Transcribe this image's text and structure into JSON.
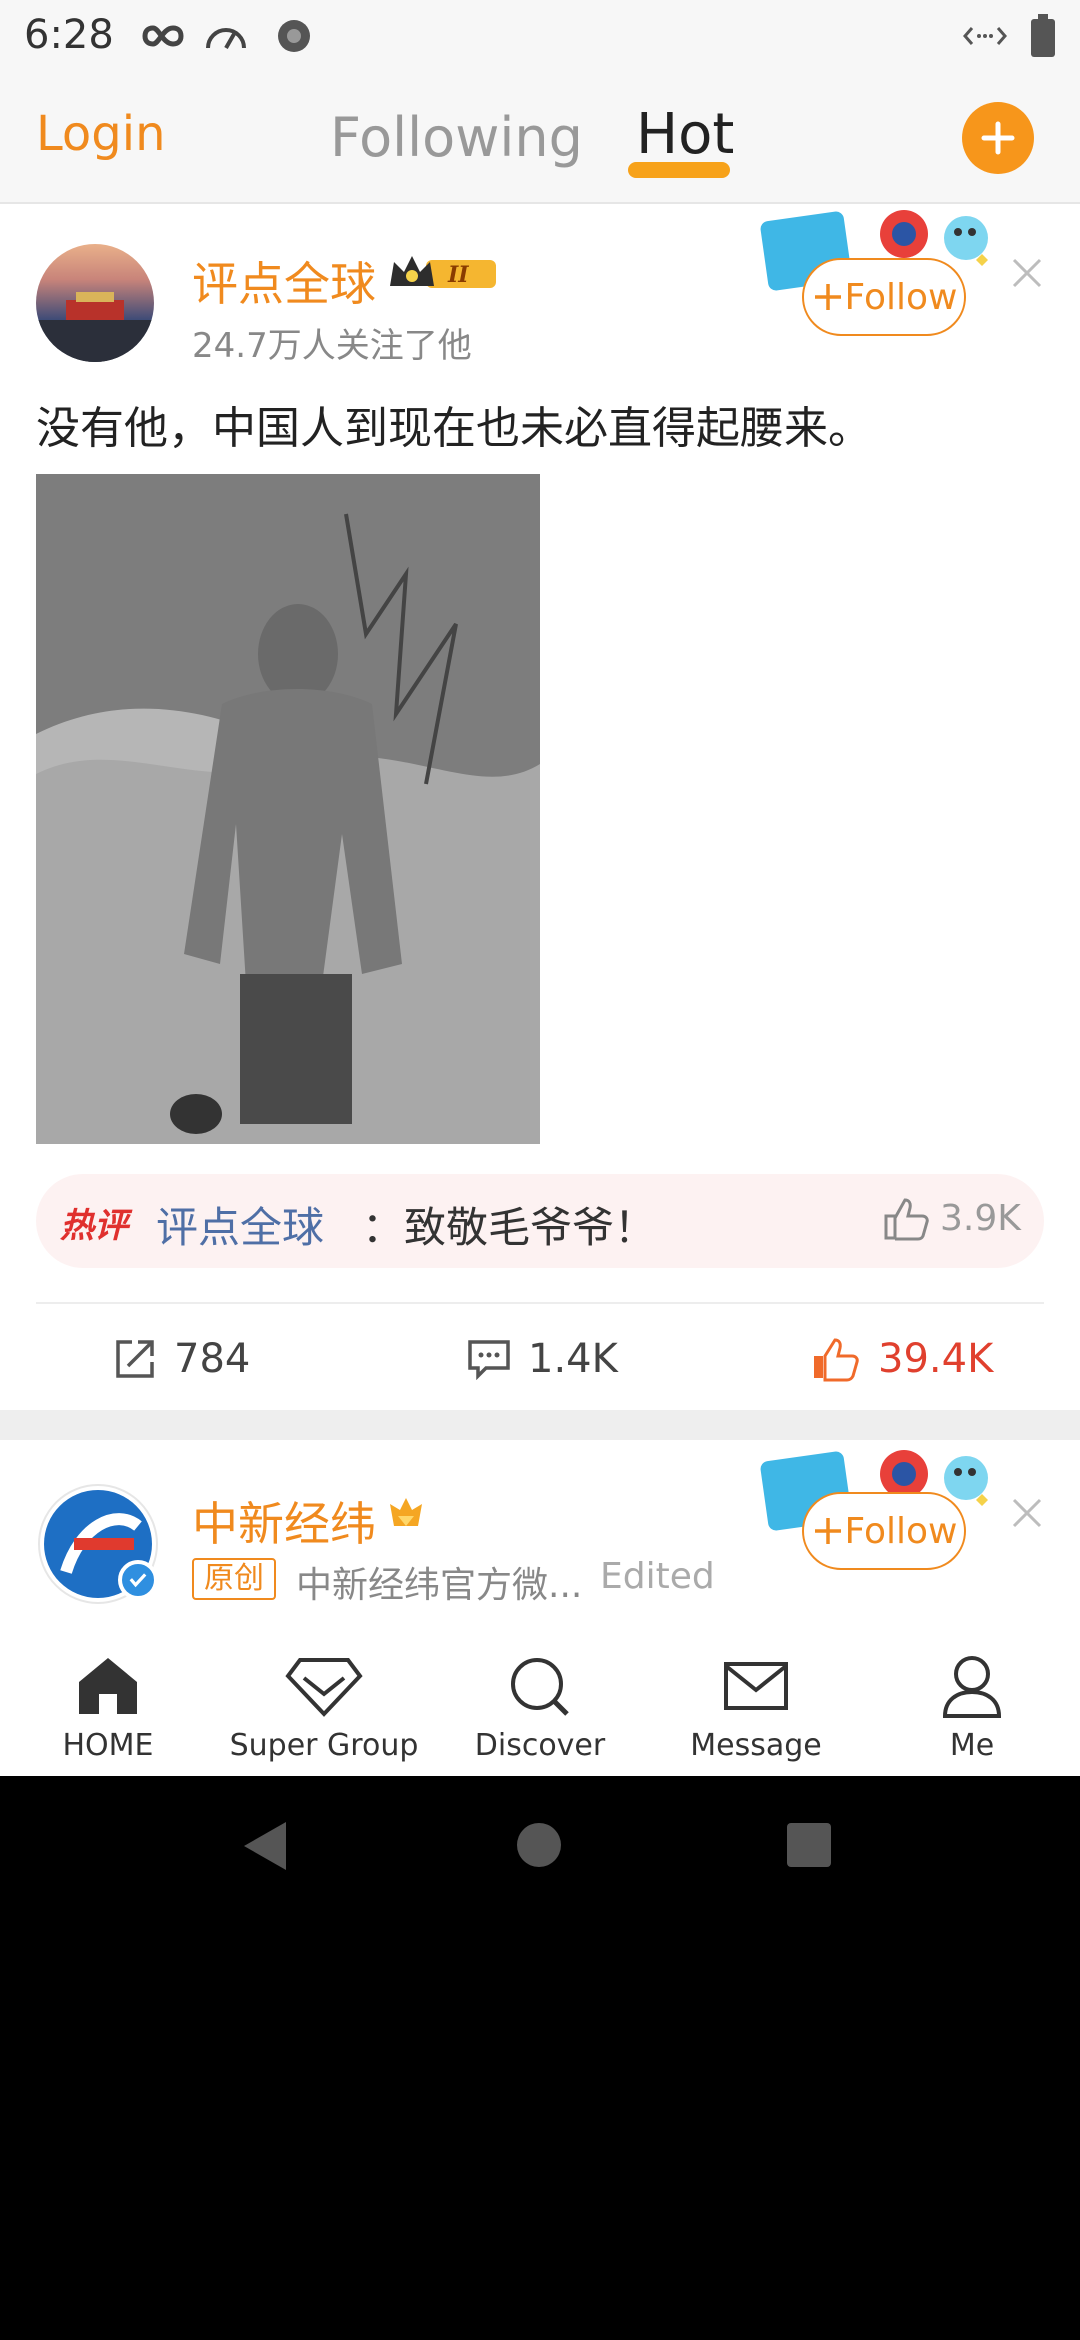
{
  "status_bar": {
    "time": "6:28"
  },
  "top_nav": {
    "login": "Login",
    "tabs": [
      {
        "label": "Following"
      },
      {
        "label": "Hot",
        "active": true
      }
    ],
    "accent_color": "#f08a1e"
  },
  "posts": [
    {
      "user_name": "评点全球",
      "followers": "24.7万人关注了他",
      "follow_label": "Follow",
      "text": "没有他，中国人到现在也未必直得起腰来。",
      "hot_comment": {
        "tag": "热评",
        "user": "评点全球",
        "text": "：致敬毛爷爷！",
        "likes": "3.9K"
      },
      "actions": {
        "reposts": "784",
        "comments": "1.4K",
        "likes": "39.4K"
      }
    },
    {
      "user_name": "中新经纬",
      "original_tag": "原创",
      "source": "中新经纬官方微...",
      "edited": "Edited",
      "follow_label": "Follow"
    }
  ],
  "bottom_nav": [
    {
      "label": "HOME",
      "icon": "home-icon"
    },
    {
      "label": "Super Group",
      "icon": "diamond-icon"
    },
    {
      "label": "Discover",
      "icon": "search-icon"
    },
    {
      "label": "Message",
      "icon": "mail-icon"
    },
    {
      "label": "Me",
      "icon": "person-icon"
    }
  ]
}
